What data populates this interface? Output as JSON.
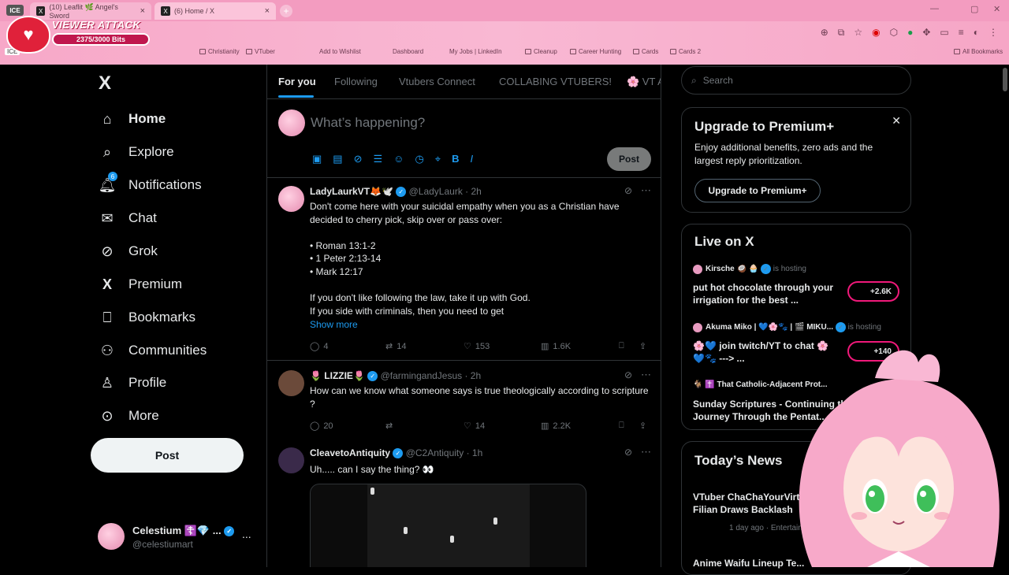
{
  "browser": {
    "ice_badge": "ICE",
    "tabs": [
      {
        "label": "(10) Leaflit 🌿 Angel's Sword",
        "active": false
      },
      {
        "label": "(6) Home / X",
        "active": true
      }
    ],
    "bookmarks": [
      "Christianity",
      "VTuber",
      "Add to Wishlist",
      "Dashboard",
      "My Jobs | LinkedIn",
      "Cleanup",
      "Career Hunting",
      "Cards",
      "Cards 2",
      "All Bookmarks"
    ],
    "bookmark_ice": "ICE"
  },
  "overlay": {
    "title": "VIEWER ATTACK",
    "bits": "2375/3000 Bits"
  },
  "nav": {
    "logo": "X",
    "items": [
      {
        "label": "Home",
        "icon": "home-icon",
        "glyph": "⌂"
      },
      {
        "label": "Explore",
        "icon": "search-icon",
        "glyph": "⌕"
      },
      {
        "label": "Notifications",
        "icon": "bell-icon",
        "glyph": "🔔",
        "badge": "6"
      },
      {
        "label": "Chat",
        "icon": "mail-icon",
        "glyph": "✉"
      },
      {
        "label": "Grok",
        "icon": "grok-icon",
        "glyph": "⊘"
      },
      {
        "label": "Premium",
        "icon": "x-icon",
        "glyph": "𝕏"
      },
      {
        "label": "Bookmarks",
        "icon": "bookmark-icon",
        "glyph": "🔖"
      },
      {
        "label": "Communities",
        "icon": "communities-icon",
        "glyph": "👥"
      },
      {
        "label": "Profile",
        "icon": "person-icon",
        "glyph": "👤"
      },
      {
        "label": "More",
        "icon": "more-circle-icon",
        "glyph": "⋯"
      }
    ],
    "notif_badge": "6",
    "post_label": "Post",
    "account": {
      "name": "Celestium ☦️💎 ...",
      "handle": "@celestiumart",
      "dots": "..."
    }
  },
  "feed": {
    "tabs": [
      "For you",
      "Following",
      "Vtubers Connect",
      "COLLABING VTUBERS!",
      "🌸 VT A"
    ],
    "compose_placeholder": "What’s happening?",
    "post_button": "Post",
    "tweets": [
      {
        "name": "LadyLaurkVT🦊🕊️",
        "handle": "@LadyLaurk · 2h",
        "body": "Don't come here with your suicidal empathy when you as a Christian have decided to cherry pick, skip over or pass over:\n\n• Roman 13:1-2\n• 1 Peter 2:13-14\n• Mark 12:17\n\nIf you don't like following the law, take it up with God.\nIf you side with criminals, then you need to get",
        "show_more": "Show more",
        "replies": "4",
        "reposts": "14",
        "likes": "153",
        "views": "1.6K"
      },
      {
        "name": "🌷 LIZZIE🌷",
        "handle": "@farmingandJesus · 2h",
        "body": "How can we know what someone says is true theologically according to scripture ?",
        "replies": "20",
        "reposts": "",
        "likes": "14",
        "views": "2.2K"
      },
      {
        "name": "CleavetoAntiquity",
        "handle": "@C2Antiquity · 1h",
        "body": "Uh..... can I say the thing? 👀"
      }
    ]
  },
  "sidebar": {
    "search_placeholder": "Search",
    "premium": {
      "title": "Upgrade to Premium+",
      "text": "Enjoy additional benefits, zero ads and the largest reply prioritization.",
      "button": "Upgrade to Premium+"
    },
    "live": {
      "title": "Live on X",
      "items": [
        {
          "host": "Kirsche 🥥 🧁",
          "status": "is hosting",
          "title": "put hot chocolate through your irrigation for the best ...",
          "count": "+2.6K"
        },
        {
          "host": "Akuma Miko | 💙🌸🐾 | 🎬 MIKU...",
          "status": "is hosting",
          "title": "🌸💙 join twitch/YT to chat 🌸💙🐾 ---> ...",
          "count": "+140"
        },
        {
          "host": "🐐 ✝️ That Catholic-Adjacent Prot...",
          "status": "",
          "title": "Sunday Scriptures - Continuing the Journey Through the Pentat...",
          "count": ""
        }
      ]
    },
    "news": {
      "title": "Today’s News",
      "items": [
        {
          "headline": "VTuber ChaChaYourVirt...",
          "headline2": "Filian Draws Backlash",
          "meta": "1 day ago · Entertainment"
        },
        {
          "headline": "Anime Waifu Lineup Te...",
          "headline2": "",
          "meta": ""
        }
      ]
    }
  }
}
